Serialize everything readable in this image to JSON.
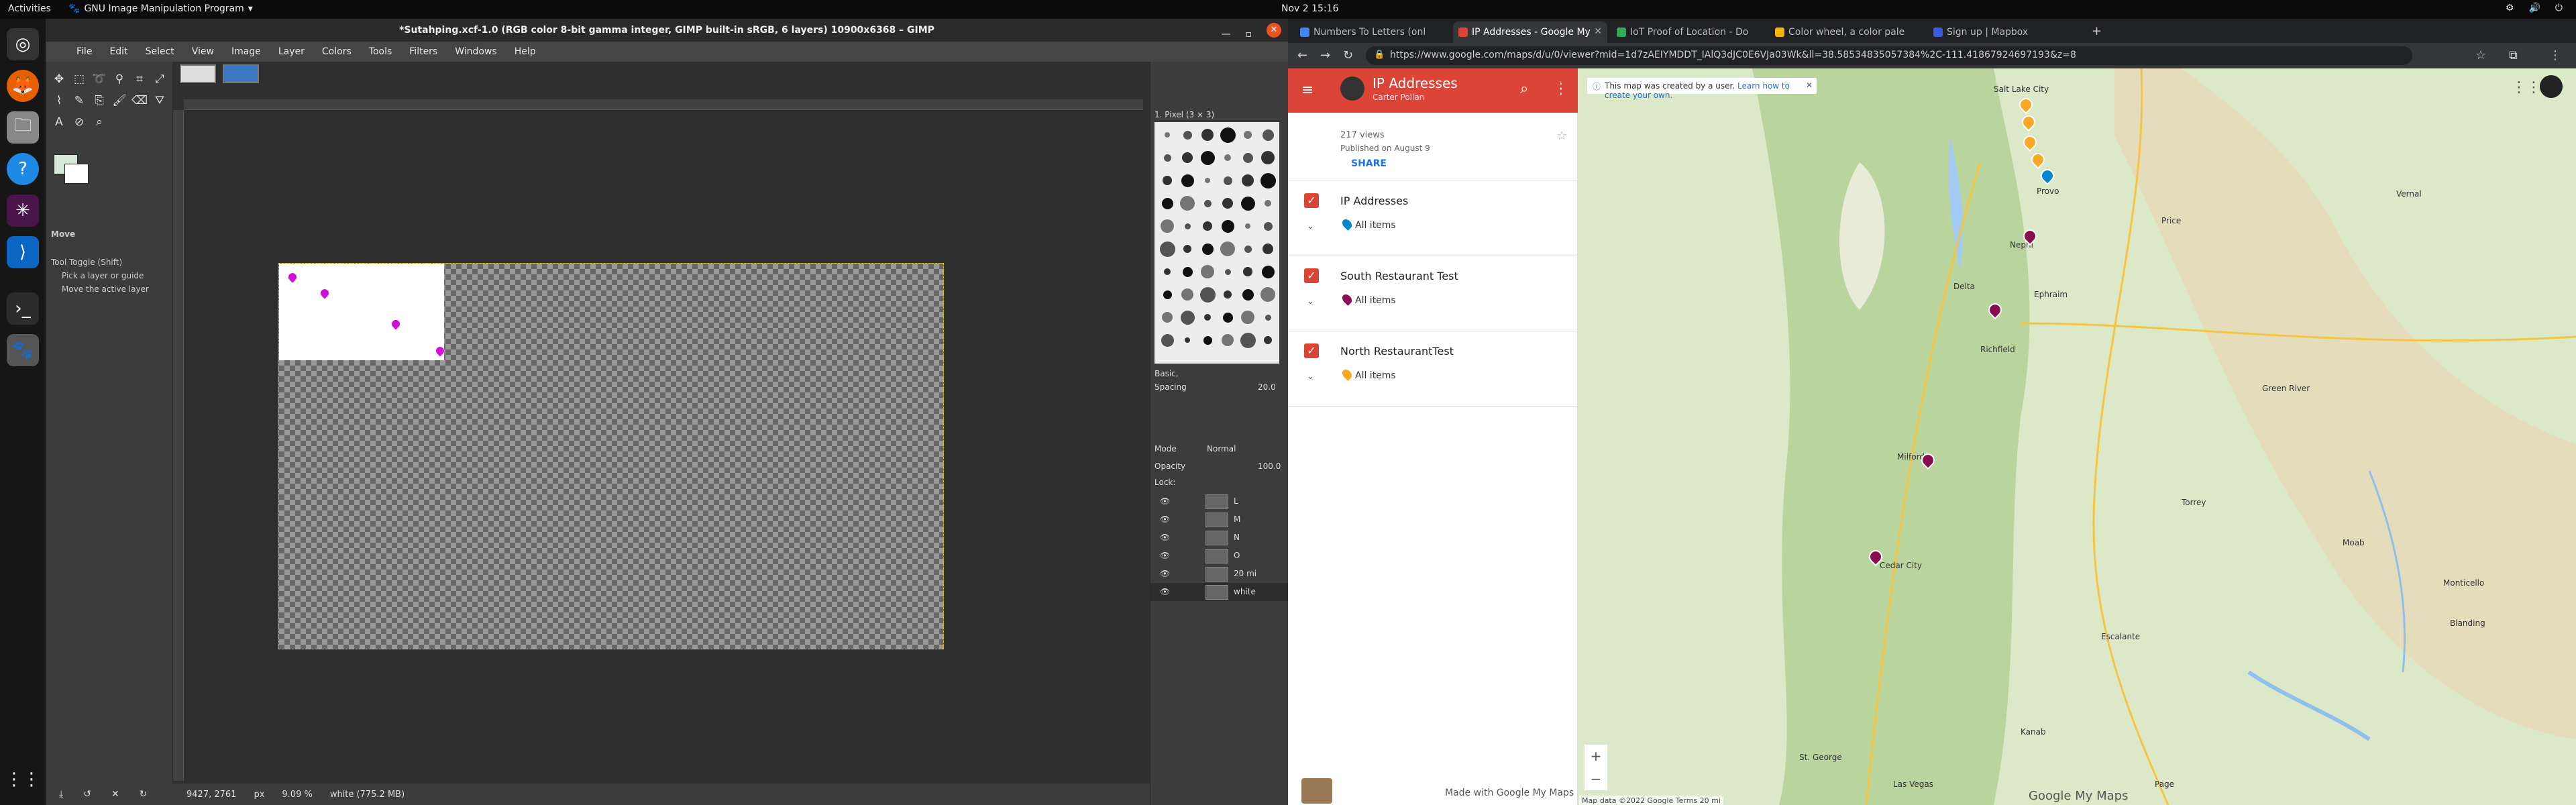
{
  "topbar": {
    "activities": "Activities",
    "app_name": "GNU Image Manipulation Program",
    "clock": "Nov 2  15:16"
  },
  "gimp": {
    "title": "*Sutahping.xcf-1.0 (RGB color 8-bit gamma integer, GIMP built-in sRGB, 6 layers) 10900x6368 – GIMP",
    "menu": [
      "File",
      "Edit",
      "Select",
      "View",
      "Image",
      "Layer",
      "Colors",
      "Tools",
      "Filters",
      "Windows",
      "Help"
    ],
    "tool_options": {
      "title": "Move",
      "toggle": "Tool Toggle (Shift)",
      "opt1": "Pick a layer or guide",
      "opt2": "Move the active layer"
    },
    "status": {
      "coords": "9427, 2761",
      "unit": "px",
      "zoom": "9.09 %",
      "info": "white (775.2 MB)"
    },
    "docks": {
      "brush_name": "1. Pixel (3 × 3)",
      "brush_preset": "Basic,",
      "spacing_label": "Spacing",
      "spacing_value": "20.0",
      "mode_label": "Mode",
      "mode_value": "Normal",
      "opacity_label": "Opacity",
      "opacity_value": "100.0",
      "lock_label": "Lock:",
      "layers": [
        "L",
        "M",
        "N",
        "O",
        "20 mi",
        "white"
      ]
    }
  },
  "chrome": {
    "tabs": [
      {
        "title": "Numbers To Letters (onl",
        "color": "#4285f4"
      },
      {
        "title": "IP Addresses - Google My",
        "color": "#db4437"
      },
      {
        "title": "IoT Proof of Location - Do",
        "color": "#34a853"
      },
      {
        "title": "Color wheel, a color pale",
        "color": "#f4b400"
      },
      {
        "title": "Sign up | Mapbox",
        "color": "#3b5bdb"
      }
    ],
    "url": "https://www.google.com/maps/d/u/0/viewer?mid=1d7zAEIYMDDT_IAlQ3dJC0E6VJa03Wk&ll=38.58534835057384%2C-111.41867924697193&z=8"
  },
  "mymaps": {
    "title": "IP Addresses",
    "author": "Carter Pollan",
    "views": "217 views",
    "published": "Published on August 9",
    "share": "SHARE",
    "layers": [
      {
        "name": "IP Addresses",
        "items": "All items",
        "pin_color": "#0288d1"
      },
      {
        "name": "South Restaurant Test",
        "items": "All items",
        "pin_color": "#880e4f"
      },
      {
        "name": "North RestaurantTest",
        "items": "All items",
        "pin_color": "#f9a825"
      }
    ],
    "footer": "Made with Google My Maps",
    "notice": "This map was created by a user.",
    "notice_link": "Learn how to create your own.",
    "map_logo": "Google My Maps",
    "map_footer": "Map data ©2022 Google   Terms   20 mi",
    "cities": [
      "Salt Lake City",
      "Provo",
      "Nephi",
      "Delta",
      "Ephraim",
      "Richfield",
      "Milford",
      "Cedar City",
      "Moab",
      "Green River",
      "Price",
      "Vernal",
      "Las Vegas",
      "Kanab",
      "Page",
      "St. George",
      "Blanding",
      "Monticello",
      "Torrey",
      "Escalante"
    ]
  }
}
